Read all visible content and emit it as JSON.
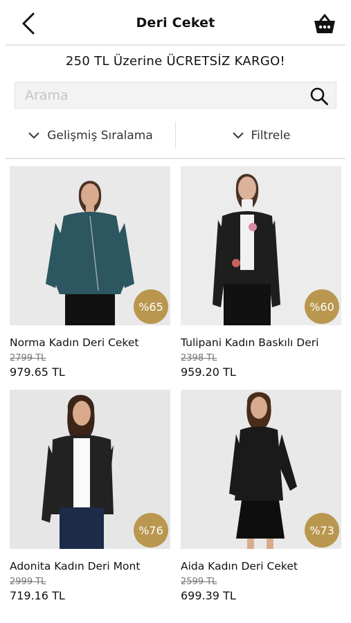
{
  "header": {
    "title": "Deri Ceket"
  },
  "promo": "250 TL Üzerine ÜCRETSİZ KARGO!",
  "search": {
    "placeholder": "Arama",
    "value": ""
  },
  "toolbar": {
    "sort_label": "Gelişmiş Sıralama",
    "filter_label": "Filtrele"
  },
  "colors": {
    "badge": "#b9974f",
    "divider": "#e3e3e3",
    "search_bg": "#f3f3f3"
  },
  "products": [
    {
      "name": "Norma Kadın Deri Ceket",
      "old_price": "2799 TL",
      "price": "979.65 TL",
      "discount": "%65",
      "jacket_color": "#2c5660",
      "bottom_color": "#111111",
      "inner_color": "#2c5660"
    },
    {
      "name": "Tulipani Kadın Baskılı Deri",
      "old_price": "2398 TL",
      "price": "959.20 TL",
      "discount": "%60",
      "jacket_color": "#1e1e1e",
      "bottom_color": "#111111",
      "inner_color": "#f1f1f1"
    },
    {
      "name": "Adonita Kadın Deri Mont",
      "old_price": "2999 TL",
      "price": "719.16 TL",
      "discount": "%76",
      "jacket_color": "#222222",
      "bottom_color": "#1c2b47",
      "inner_color": "#fafafa"
    },
    {
      "name": "Aida Kadın Deri Ceket",
      "old_price": "2599 TL",
      "price": "699.39 TL",
      "discount": "%73",
      "jacket_color": "#1a1a1a",
      "bottom_color": "#0e0e0e",
      "inner_color": "#1a1a1a"
    }
  ]
}
